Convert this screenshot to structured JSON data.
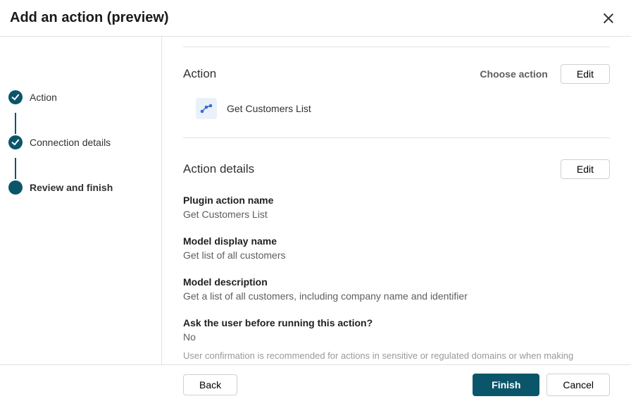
{
  "header": {
    "title": "Add an action (preview)"
  },
  "sidebar": {
    "steps": [
      {
        "label": "Action",
        "done": true
      },
      {
        "label": "Connection details",
        "done": true
      },
      {
        "label": "Review and finish",
        "done": false,
        "current": true
      }
    ]
  },
  "action_section": {
    "title": "Action",
    "choose_label": "Choose action",
    "edit_label": "Edit",
    "selected_action": "Get Customers List"
  },
  "details_section": {
    "title": "Action details",
    "edit_label": "Edit",
    "fields": {
      "plugin_action_name": {
        "label": "Plugin action name",
        "value": "Get Customers List"
      },
      "model_display_name": {
        "label": "Model display name",
        "value": "Get list of all customers"
      },
      "model_description": {
        "label": "Model description",
        "value": "Get a list of all customers, including company name and identifier"
      },
      "confirm": {
        "label": "Ask the user before running this action?",
        "value": "No",
        "hint": "User confirmation is recommended for actions in sensitive or regulated domains or when making changes for the"
      }
    }
  },
  "footer": {
    "back": "Back",
    "finish": "Finish",
    "cancel": "Cancel"
  }
}
